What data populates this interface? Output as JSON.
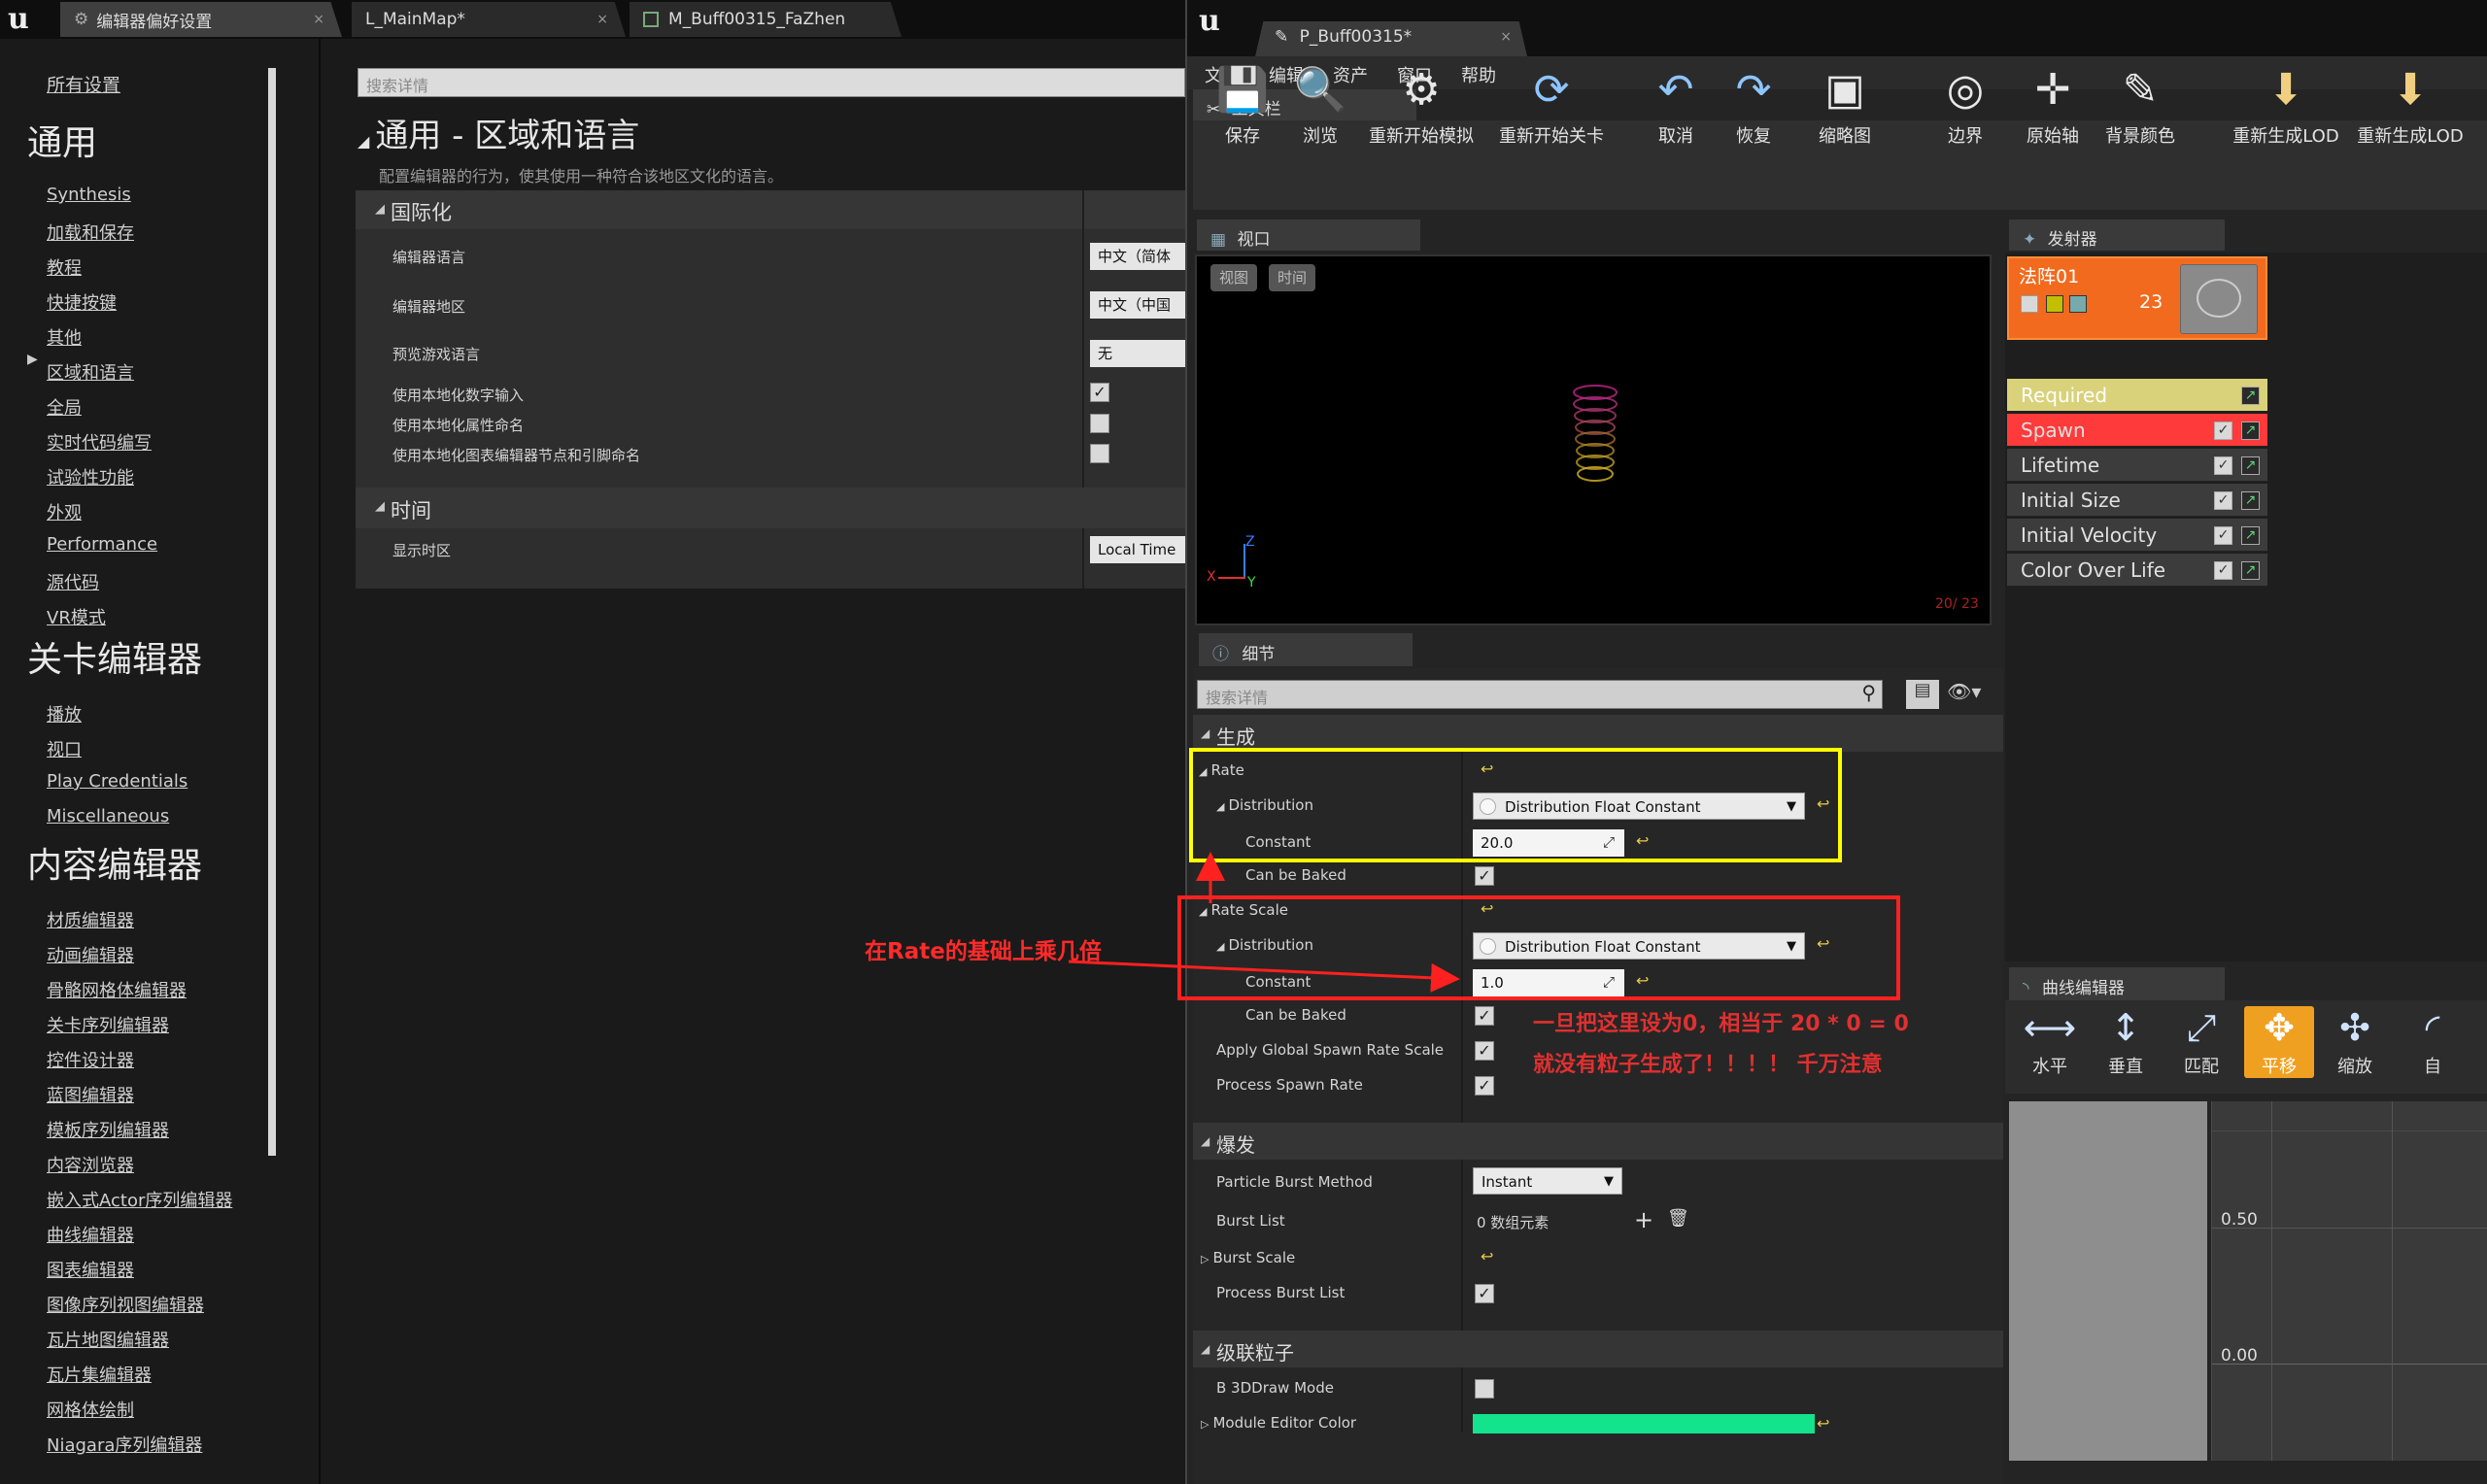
{
  "left_window": {
    "tabs": [
      "编辑器偏好设置",
      "L_MainMap*",
      "M_Buff00315_FaZhen"
    ],
    "nav": {
      "all_settings": "所有设置",
      "sections": [
        {
          "title": "通用",
          "items": [
            "Synthesis",
            "加载和保存",
            "教程",
            "快捷按键",
            "其他",
            "区域和语言",
            "全局",
            "实时代码编写",
            "试验性功能",
            "外观",
            "Performance",
            "源代码",
            "VR模式"
          ]
        },
        {
          "title": "关卡编辑器",
          "items": [
            "播放",
            "视口",
            "Play Credentials",
            "Miscellaneous"
          ]
        },
        {
          "title": "内容编辑器",
          "items": [
            "材质编辑器",
            "动画编辑器",
            "骨骼网格体编辑器",
            "关卡序列编辑器",
            "控件设计器",
            "蓝图编辑器",
            "模板序列编辑器",
            "内容浏览器",
            "嵌入式Actor序列编辑器",
            "曲线编辑器",
            "图表编辑器",
            "图像序列视图编辑器",
            "瓦片地图编辑器",
            "瓦片集编辑器",
            "网格体绘制",
            "Niagara序列编辑器"
          ]
        }
      ]
    },
    "search_placeholder": "搜索详情",
    "page_title": "通用 - 区域和语言",
    "page_desc": "配置编辑器的行为，使其使用一种符合该地区文化的语言。",
    "intl": {
      "header": "国际化",
      "editor_language": {
        "label": "编辑器语言",
        "value": "中文（简体"
      },
      "editor_region": {
        "label": "编辑器地区",
        "value": "中文（中国"
      },
      "preview_language": {
        "label": "预览游戏语言",
        "value": "无"
      },
      "check1": "使用本地化数字输入",
      "check2": "使用本地化属性命名",
      "check3": "使用本地化图表编辑器节点和引脚命名"
    },
    "time": {
      "header": "时间",
      "label": "显示时区",
      "value": "Local Time"
    }
  },
  "right_window": {
    "tab": "P_Buff00315*",
    "menu": [
      "文件",
      "编辑",
      "资产",
      "窗口",
      "帮助"
    ],
    "toolbar_tab": "工具栏",
    "toolbar": [
      {
        "label": "保存",
        "icon": "save-icon"
      },
      {
        "label": "浏览",
        "icon": "browse-icon"
      },
      {
        "label": "重新开始模拟",
        "icon": "restart-sim-icon"
      },
      {
        "label": "重新开始关卡",
        "icon": "restart-level-icon"
      },
      {
        "label": "取消",
        "icon": "undo-icon"
      },
      {
        "label": "恢复",
        "icon": "redo-icon"
      },
      {
        "label": "缩略图",
        "icon": "thumbnail-icon"
      },
      {
        "label": "边界",
        "icon": "bounds-icon"
      },
      {
        "label": "原始轴",
        "icon": "origin-axis-icon"
      },
      {
        "label": "背景颜色",
        "icon": "bg-color-icon"
      },
      {
        "label": "重新生成LOD",
        "icon": "regen-lod-icon"
      },
      {
        "label": "重新生成LOD",
        "icon": "regen-lod-icon"
      }
    ],
    "viewport": {
      "tab": "视口",
      "btn_view": "视图",
      "btn_time": "时间",
      "counter": "20/ 23",
      "axis_z": "Z",
      "axis_x": "X",
      "axis_y": "Y"
    },
    "emitters": {
      "tab": "发射器",
      "name": "法阵01",
      "count": "23",
      "modules": [
        "Required",
        "Spawn",
        "Lifetime",
        "Initial Size",
        "Initial Velocity",
        "Color Over Life"
      ]
    },
    "details": {
      "tab": "细节",
      "search_placeholder": "搜索详情",
      "spawn_header": "生成",
      "rate": "Rate",
      "distribution": "Distribution",
      "dist_value": "Distribution Float Constant",
      "constant": "Constant",
      "rate_constant": "20.0",
      "can_be_baked": "Can be Baked",
      "rate_scale": "Rate Scale",
      "rate_scale_constant": "1.0",
      "apply_global": "Apply Global Spawn Rate Scale",
      "process_spawn": "Process Spawn Rate",
      "burst_header": "爆发",
      "burst_method": "Particle Burst Method",
      "burst_method_value": "Instant",
      "burst_list": "Burst List",
      "burst_list_value": "0 数组元素",
      "burst_scale": "Burst Scale",
      "process_burst": "Process Burst List",
      "cascade_header": "级联粒子",
      "draw_mode": "B 3DDraw Mode",
      "module_color": "Module Editor Color"
    },
    "curve_editor": {
      "tab": "曲线编辑器",
      "buttons": [
        "水平",
        "垂直",
        "匹配",
        "平移",
        "缩放",
        "自"
      ],
      "y1": "0.50",
      "y2": "0.00"
    }
  },
  "annotations": {
    "left_note": "在Rate的基础上乘几倍",
    "right_note_1": "一旦把这里设为0，相当于 20 * 0 = 0",
    "right_note_2": "就没有粒子生成了！！！！ 千万注意"
  },
  "colors": {
    "accent": "#f0a020",
    "highlight_yellow": "#ffff00",
    "highlight_red": "#ff2020",
    "spawn_red": "#ff3a3a",
    "required_yellow": "#d9d27a",
    "module_color": "#12e38c"
  }
}
